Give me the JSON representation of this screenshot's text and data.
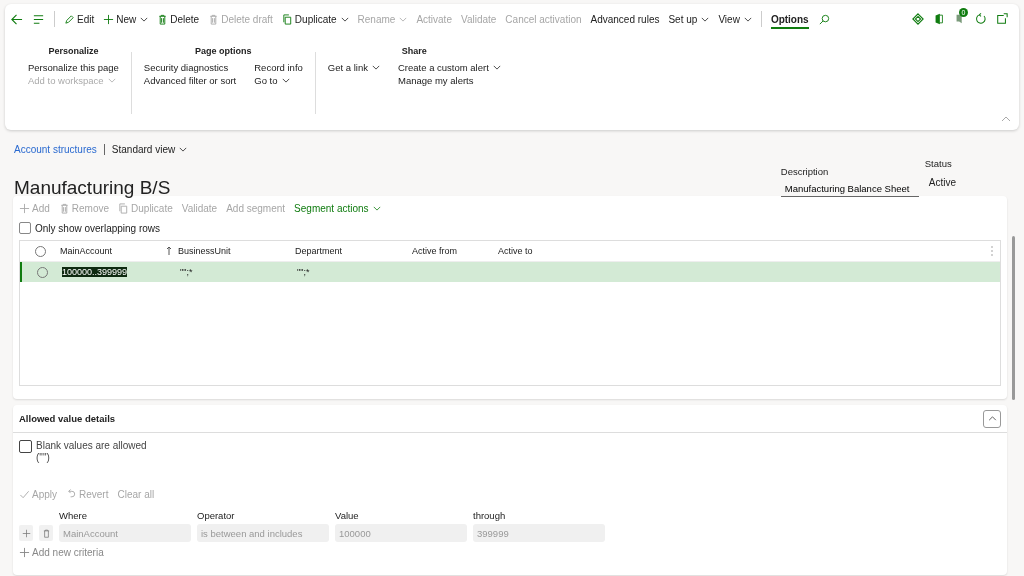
{
  "toolbar": {
    "items": [
      {
        "kind": "edit",
        "label": "Edit",
        "disabled": false,
        "dropdown": false,
        "selected": false
      },
      {
        "kind": "new",
        "label": "New",
        "disabled": false,
        "dropdown": true,
        "selected": false
      },
      {
        "kind": "delete",
        "label": "Delete",
        "disabled": false,
        "dropdown": false,
        "selected": false
      },
      {
        "kind": "delete",
        "label": "Delete draft",
        "disabled": true,
        "dropdown": false,
        "selected": false
      },
      {
        "kind": "copy",
        "label": "Duplicate",
        "disabled": false,
        "dropdown": true,
        "selected": false
      },
      {
        "kind": "text",
        "label": "Rename",
        "disabled": true,
        "dropdown": true,
        "selected": false
      },
      {
        "kind": "text",
        "label": "Activate",
        "disabled": true,
        "dropdown": false,
        "selected": false
      },
      {
        "kind": "text",
        "label": "Validate",
        "disabled": true,
        "dropdown": false,
        "selected": false
      },
      {
        "kind": "text",
        "label": "Cancel activation",
        "disabled": true,
        "dropdown": false,
        "selected": false
      },
      {
        "kind": "text",
        "label": "Advanced rules",
        "disabled": false,
        "dropdown": false,
        "selected": false
      },
      {
        "kind": "text",
        "label": "Set up",
        "disabled": false,
        "dropdown": true,
        "selected": false
      },
      {
        "kind": "text",
        "label": "View",
        "disabled": false,
        "dropdown": true,
        "selected": false
      },
      {
        "kind": "text",
        "label": "Options",
        "disabled": false,
        "dropdown": false,
        "selected": true
      }
    ],
    "notification_count": "0"
  },
  "action_pane": {
    "groups": [
      {
        "title": "Personalize",
        "columns": [
          [
            {
              "label": "Personalize this page",
              "disabled": false,
              "dropdown": false
            },
            {
              "label": "Add to workspace",
              "disabled": true,
              "dropdown": true
            }
          ]
        ]
      },
      {
        "title": "Page options",
        "columns": [
          [
            {
              "label": "Security diagnostics",
              "disabled": false,
              "dropdown": false
            },
            {
              "label": "Advanced filter or sort",
              "disabled": false,
              "dropdown": false
            }
          ],
          [
            {
              "label": "Record info",
              "disabled": false,
              "dropdown": false
            },
            {
              "label": "Go to",
              "disabled": false,
              "dropdown": true
            }
          ]
        ]
      },
      {
        "title": "Share",
        "columns": [
          [
            {
              "label": "Get a link",
              "disabled": false,
              "dropdown": true
            }
          ],
          [
            {
              "label": "Create a custom alert",
              "disabled": false,
              "dropdown": true
            },
            {
              "label": "Manage my alerts",
              "disabled": false,
              "dropdown": false
            }
          ]
        ]
      }
    ]
  },
  "breadcrumb": {
    "link": "Account structures",
    "view": "Standard view"
  },
  "title": "Manufacturing B/S",
  "description": {
    "label": "Description",
    "value": "Manufacturing Balance Sheet"
  },
  "status": {
    "label": "Status",
    "value": "Active"
  },
  "grid_toolbar": [
    {
      "kind": "add",
      "label": "Add",
      "disabled": true,
      "dropdown": false
    },
    {
      "kind": "delete",
      "label": "Remove",
      "disabled": true,
      "dropdown": false
    },
    {
      "kind": "copy",
      "label": "Duplicate",
      "disabled": true,
      "dropdown": false
    },
    {
      "kind": "text",
      "label": "Validate",
      "disabled": true,
      "dropdown": false
    },
    {
      "kind": "text",
      "label": "Add segment",
      "disabled": true,
      "dropdown": false
    },
    {
      "kind": "text",
      "label": "Segment actions",
      "disabled": false,
      "dropdown": true
    }
  ],
  "overlap_filter": {
    "label": "Only show overlapping rows",
    "checked": false
  },
  "table": {
    "columns": [
      {
        "label": "MainAccount",
        "sorted": true
      },
      {
        "label": "BusinessUnit",
        "sorted": false
      },
      {
        "label": "Department",
        "sorted": false
      },
      {
        "label": "Active from",
        "sorted": false
      },
      {
        "label": "Active to",
        "sorted": false
      }
    ],
    "all_selected": false,
    "rows": [
      {
        "selected": true,
        "checked": false,
        "text_selected": true,
        "cells": [
          "100000..399999",
          "\"\";*",
          "\"\";*"
        ]
      }
    ]
  },
  "allowed_values": {
    "title": "Allowed value details",
    "expanded": true,
    "blank": {
      "label": "Blank values are allowed",
      "note": "(\"\")",
      "checked": false
    },
    "actions": [
      {
        "kind": "apply",
        "label": "Apply",
        "disabled": true
      },
      {
        "kind": "revert",
        "label": "Revert",
        "disabled": true
      },
      {
        "kind": "text",
        "label": "Clear all",
        "disabled": true
      }
    ],
    "columns": [
      "Where",
      "Operator",
      "Value",
      "through"
    ],
    "criteria": [
      {
        "where": "MainAccount",
        "operator": "is between and includes",
        "value": "100000",
        "through": "399999"
      }
    ],
    "add_label": "Add new criteria"
  }
}
